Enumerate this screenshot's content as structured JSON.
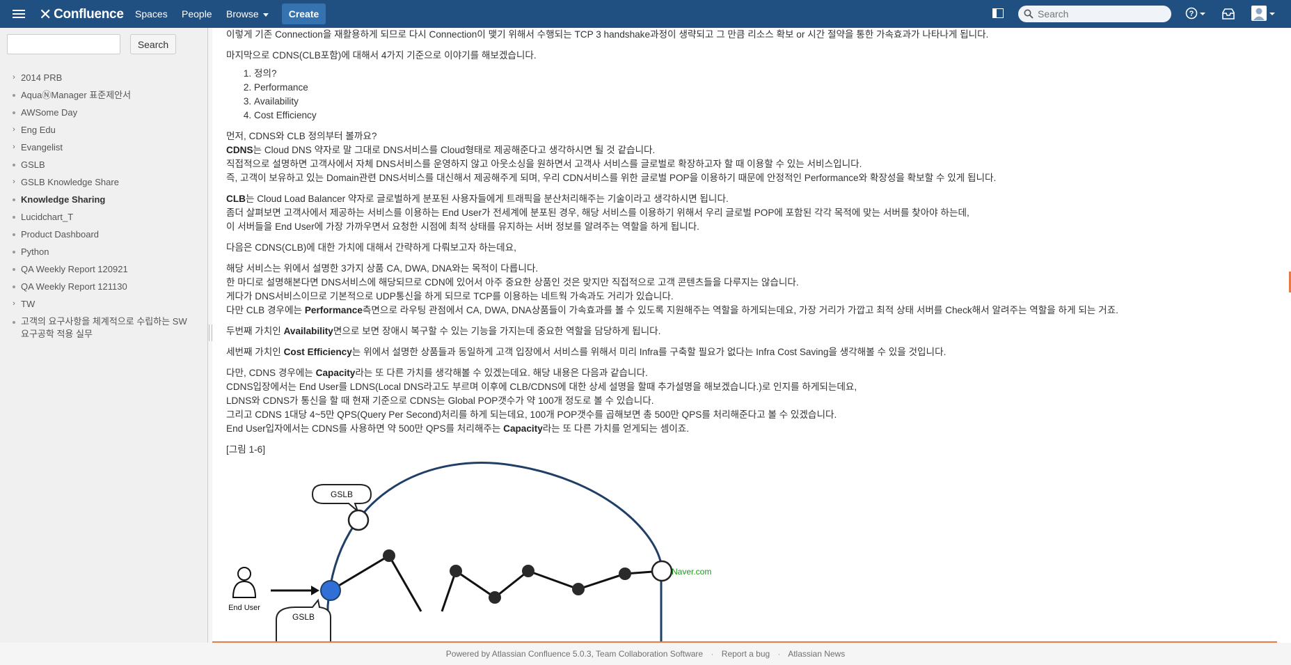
{
  "header": {
    "logo": "Confluence",
    "nav": [
      "Spaces",
      "People",
      "Browse"
    ],
    "create_label": "Create",
    "search_placeholder": "Search"
  },
  "sidebar": {
    "search_button": "Search",
    "items": [
      {
        "label": "2014 PRB",
        "marker": "chevron"
      },
      {
        "label": "AquaⓃManager 표준제안서",
        "marker": "dot"
      },
      {
        "label": "AWSome Day",
        "marker": "dot"
      },
      {
        "label": "Eng Edu",
        "marker": "chevron"
      },
      {
        "label": "Evangelist",
        "marker": "chevron"
      },
      {
        "label": "GSLB",
        "marker": "dot"
      },
      {
        "label": "GSLB Knowledge Share",
        "marker": "chevron"
      },
      {
        "label": "Knowledge Sharing",
        "marker": "dot",
        "bold": true
      },
      {
        "label": "Lucidchart_T",
        "marker": "dot"
      },
      {
        "label": "Product Dashboard",
        "marker": "dot"
      },
      {
        "label": "Python",
        "marker": "dot"
      },
      {
        "label": "QA Weekly Report 120921",
        "marker": "dot"
      },
      {
        "label": "QA Weekly Report 121130",
        "marker": "dot"
      },
      {
        "label": "TW",
        "marker": "chevron"
      },
      {
        "label": "고객의 요구사항을 체계적으로 수립하는 SW 요구공학 적용 실무",
        "marker": "dot"
      }
    ]
  },
  "content": {
    "l1": "이렇게 기존 Connection을 재활용하게 되므로 다시 Connection이 맺기 위해서 수행되는 TCP 3 handshake과정이 생략되고 그 만큼 리소스 확보 or 시간 절약을 통한 가속효과가 나타나게 됩니다.",
    "l2": "마지막으로 CDNS(CLB포함)에 대해서 4가지 기준으로 이야기를 해보겠습니다.",
    "list": [
      "정의?",
      "Performance",
      "Availability",
      "Cost Efficiency"
    ],
    "l3": "먼저, CDNS와 CLB 정의부터 볼까요?",
    "l4_b": "CDNS",
    "l4": "는 Cloud DNS 약자로 말 그대로 DNS서비스를 Cloud형태로 제공해준다고 생각하시면 될 것 같습니다.",
    "l5": "직접적으로 설명하면 고객사에서 자체 DNS서비스를 운영하지 않고 아웃소싱을 원하면서 고객사 서비스를 글로벌로 확장하고자 할 때 이용할 수 있는 서비스입니다.",
    "l6": "즉, 고객이 보유하고 있는 Domain관련 DNS서비스를 대신해서 제공해주게 되며, 우리 CDN서비스를 위한 글로벌 POP을 이용하기 때문에 안정적인 Performance와 확장성을 확보할 수 있게 됩니다.",
    "l7_b": "CLB",
    "l7": "는 Cloud Load Balancer 약자로 글로벌하게 분포된 사용자들에게 트래픽을 분산처리해주는 기술이라고 생각하시면 됩니다.",
    "l8": "좀더 살펴보면 고객사에서 제공하는 서비스를 이용하는 End User가 전세계에 분포된 경우, 해당 서비스를 이용하기 위해서 우리 글로벌 POP에 포함된 각각 목적에 맞는 서버를 찾아야 하는데,",
    "l9": "이 서버들을 End User에 가장 가까우면서 요청한 시점에 최적 상태를 유지하는 서버 정보를 알려주는 역할을 하게 됩니다.",
    "l10": "다음은 CDNS(CLB)에 대한 가치에 대해서 간략하게 다뤄보고자 하는데요,",
    "l11": "해당 서비스는 위에서 설명한 3가지 상품 CA, DWA, DNA와는 목적이 다릅니다.",
    "l12": "한 마디로 설명해본다면 DNS서비스에 해당되므로 CDN에 있어서 아주 중요한 상품인 것은 맞지만 직접적으로 고객 콘텐츠들을 다루지는 않습니다.",
    "l13": "게다가 DNS서비스이므로 기본적으로 UDP통신을 하게 되므로 TCP를 이용하는 네트웍 가속과도 거리가 있습니다.",
    "l14_a": "다만 CLB 경우에는 ",
    "l14_b": "Performance",
    "l14_c": "측면으로 라우팅 관점에서 CA, DWA, DNA상품들이 가속효과를 볼 수 있도록 지원해주는 역할을 하게되는데요, 가장 거리가 가깝고 최적 상태 서버를 Check해서 알려주는 역할을 하게 되는 거죠.",
    "l15_a": "두번째 가치인 ",
    "l15_b": "Availability",
    "l15_c": "면으로 보면 장애시 복구할 수 있는 기능을 가지는데 중요한 역할을 담당하게 됩니다.",
    "l16_a": "세번째 가치인 ",
    "l16_b": "Cost Efficiency",
    "l16_c": "는 위에서 설명한 상품들과 동일하게 고객 입장에서 서비스를 위해서 미리 Infra를 구축할 필요가 없다는 Infra Cost Saving을 생각해볼 수 있을 것입니다.",
    "l17_a": "다만, CDNS 경우에는 ",
    "l17_b": "Capacity",
    "l17_c": "라는 또 다른 가치를 생각해볼 수 있겠는데요. 해당 내용은 다음과 같습니다.",
    "l18": "CDNS입장에서는 End User를 LDNS(Local DNS라고도 부르며 이후에 CLB/CDNS에 대한 상세 설명을 할때 추가설명을 해보겠습니다.)로 인지를 하게되는데요,",
    "l19": "LDNS와 CDNS가 통신을 할 때 현재 기준으로 CDNS는 Global POP갯수가 약 100개 정도로 볼 수 있습니다.",
    "l20": "그리고 CDNS 1대당 4~5만 QPS(Query Per Second)처리를 하게 되는데요, 100개 POP갯수를 곱해보면 총 500만 QPS를 처리해준다고 볼 수 있겠습니다.",
    "l21_a": "End User입자에서는 CDNS를 사용하면 약 500만 QPS를 처리해주는 ",
    "l21_b": "Capacity",
    "l21_c": "라는 또 다른 가치를 얻게되는 셈이죠.",
    "fig_caption": "[그림 1-6]",
    "fig": {
      "gslb_top": "GSLB",
      "gslb_bottom": "GSLB",
      "end_user": "End User",
      "naver": "Naver.com",
      "naver_color": "#1a9a1a",
      "ring_color": "#1f3f66",
      "node_blue": "#2f6fd6"
    }
  },
  "footer": {
    "powered": "Powered by Atlassian Confluence 5.0.3, Team Collaboration Software",
    "report": "Report a bug",
    "news": "Atlassian News"
  }
}
